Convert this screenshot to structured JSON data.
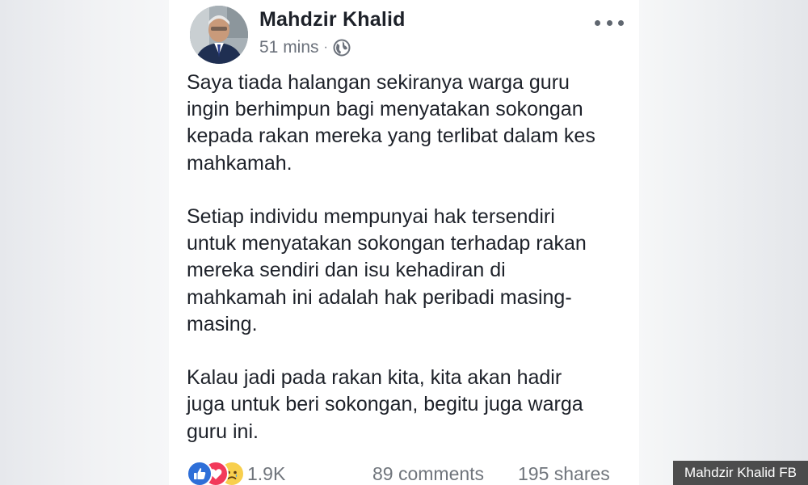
{
  "post": {
    "author": "Mahdzir Khalid",
    "time": "51 mins",
    "separator": "·",
    "privacy_icon": "globe-icon",
    "menu_icon": "more-options-icon",
    "paragraphs": [
      [
        "Saya tiada halangan sekiranya warga guru",
        "ingin berhimpun bagi menyatakan sokongan",
        "kepada rakan mereka yang terlibat dalam kes",
        "mahkamah."
      ],
      [
        "Setiap individu mempunyai hak tersendiri",
        "untuk menyatakan sokongan terhadap rakan",
        "mereka sendiri dan isu kehadiran di",
        "mahkamah ini adalah hak peribadi masing-",
        "masing."
      ],
      [
        "Kalau jadi pada rakan kita, kita akan hadir",
        "juga untuk beri sokongan, begitu juga warga",
        "guru ini."
      ]
    ]
  },
  "engagement": {
    "reaction_icons": [
      "like-icon",
      "love-icon",
      "sad-icon"
    ],
    "reaction_count": "1.9K",
    "comments": "89 comments",
    "shares": "195 shares"
  },
  "credit": "Mahdzir Khalid FB",
  "colors": {
    "text": "#1d2129",
    "meta": "#6b717b",
    "like": "#2e6fd8",
    "love": "#f2395a",
    "sad": "#f8cf4d"
  }
}
